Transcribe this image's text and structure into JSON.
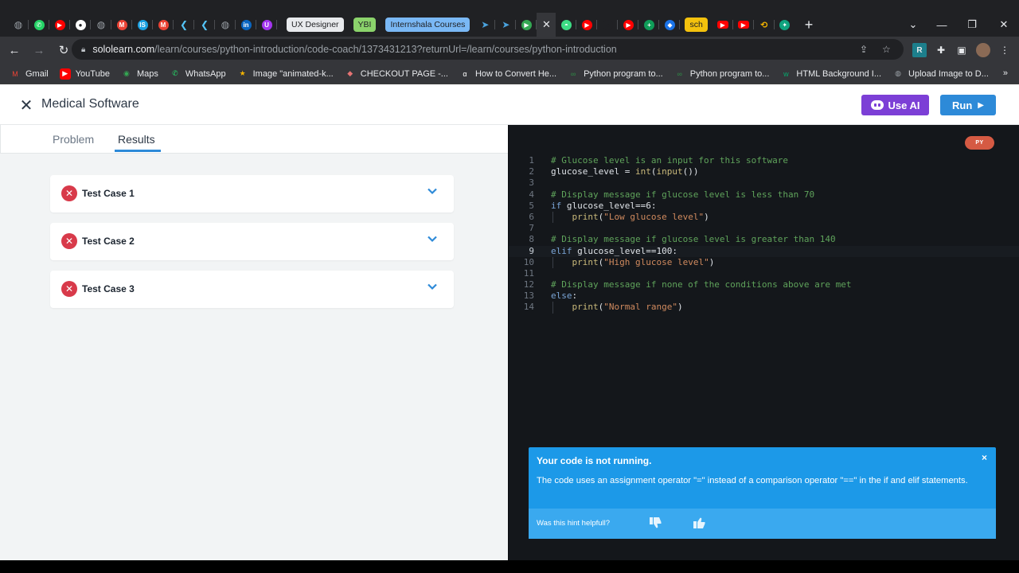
{
  "browser": {
    "tabs": [
      {
        "icon": "globe-icon",
        "color": "#9aa0a6"
      },
      {
        "icon": "whatsapp-icon",
        "color": "#25d366"
      },
      {
        "icon": "youtube-icon",
        "color": "#ff0000"
      },
      {
        "icon": "github-icon",
        "color": "#ffffff"
      },
      {
        "icon": "globe-icon",
        "color": "#9aa0a6"
      },
      {
        "icon": "gmail-icon",
        "color": "#ea4335"
      },
      {
        "icon": "internshala-icon",
        "color": "#1ba1e2"
      },
      {
        "icon": "gmail-icon",
        "color": "#ea4335"
      },
      {
        "icon": "flutter-icon",
        "color": "#54c5f8"
      },
      {
        "icon": "flutter-icon",
        "color": "#54c5f8"
      },
      {
        "icon": "globe-icon",
        "color": "#9aa0a6"
      },
      {
        "icon": "linkedin-icon",
        "color": "#0a66c2"
      },
      {
        "icon": "udemy-icon",
        "color": "#a435f0"
      }
    ],
    "tab_chips": [
      {
        "label": "UX Designer",
        "bg": "#e8eaed",
        "fg": "#202124"
      },
      {
        "label": "YBI",
        "bg": "#8bd36b",
        "fg": "#202124"
      },
      {
        "label": "Internshala Courses",
        "bg": "#7ab8f5",
        "fg": "#202124"
      }
    ],
    "right_tabs": [
      {
        "icon": "send-icon",
        "color": "#4aa3df"
      },
      {
        "icon": "send-icon",
        "color": "#4aa3df"
      },
      {
        "icon": "play-store-icon",
        "color": "#34a853"
      },
      {
        "icon": "close-icon",
        "color": "#e8eaed"
      },
      {
        "icon": "android-icon",
        "color": "#3ddc84"
      },
      {
        "icon": "youtube-icon",
        "color": "#ff0000"
      },
      {
        "icon": "github-icon",
        "color": "#202124"
      },
      {
        "icon": "youtube-icon",
        "color": "#ff0000"
      },
      {
        "icon": "plus-box-icon",
        "color": "#0f9d58"
      },
      {
        "icon": "shield-icon",
        "color": "#1a73e8"
      }
    ],
    "sch_chip": {
      "label": "sch",
      "bg": "#f4c20d",
      "fg": "#202124"
    },
    "url_host": "sololearn.com",
    "url_rest": "/learn/courses/python-introduction/code-coach/1373431213?returnUrl=/learn/courses/python-introduction",
    "bookmarks": [
      {
        "label": "Gmail",
        "icon": "gmail-icon",
        "color": "#ea4335"
      },
      {
        "label": "YouTube",
        "icon": "youtube-icon",
        "color": "#ff0000"
      },
      {
        "label": "Maps",
        "icon": "maps-icon",
        "color": "#34a853"
      },
      {
        "label": "WhatsApp",
        "icon": "whatsapp-icon",
        "color": "#25d366"
      },
      {
        "label": "Image \"animated-k...",
        "icon": "star-icon",
        "color": "#f4b400"
      },
      {
        "label": "CHECKOUT PAGE -...",
        "icon": "lips-icon",
        "color": "#e57373"
      },
      {
        "label": "How to Convert He...",
        "icon": "alpha-icon",
        "color": "#ffffff"
      },
      {
        "label": "Python program to...",
        "icon": "gfg-icon",
        "color": "#2f8d46"
      },
      {
        "label": "Python program to...",
        "icon": "gfg-icon",
        "color": "#2f8d46"
      },
      {
        "label": "HTML Background I...",
        "icon": "w3-icon",
        "color": "#04aa6d"
      },
      {
        "label": "Upload Image to D...",
        "icon": "globe-icon",
        "color": "#9aa0a6"
      }
    ],
    "bookmarks_more": "»"
  },
  "page": {
    "title": "Medical Software",
    "use_ai_label": "Use AI",
    "run_label": "Run",
    "tabs": {
      "problem": "Problem",
      "results": "Results"
    },
    "test_cases": [
      {
        "label": "Test Case 1",
        "status": "failed"
      },
      {
        "label": "Test Case 2",
        "status": "failed"
      },
      {
        "label": "Test Case 3",
        "status": "failed"
      }
    ],
    "language_badge": "PY",
    "colors": {
      "accent": "#2d8ad8",
      "ai": "#7c3fd6",
      "fail": "#d83a4a",
      "hint": "#1c99e8"
    }
  },
  "code": [
    {
      "n": "1",
      "tokens": [
        {
          "t": "# Glucose level is an input for this software",
          "c": "comment"
        }
      ]
    },
    {
      "n": "2",
      "tokens": [
        {
          "t": "glucose_level ",
          "c": "plain"
        },
        {
          "t": "=",
          "c": "op"
        },
        {
          "t": " ",
          "c": "plain"
        },
        {
          "t": "int",
          "c": "builtin"
        },
        {
          "t": "(",
          "c": "plain"
        },
        {
          "t": "input",
          "c": "builtin"
        },
        {
          "t": "())",
          "c": "plain"
        }
      ]
    },
    {
      "n": "3",
      "tokens": []
    },
    {
      "n": "4",
      "tokens": [
        {
          "t": "# Display message if glucose level is less than 70",
          "c": "comment"
        }
      ]
    },
    {
      "n": "5",
      "tokens": [
        {
          "t": "if",
          "c": "keyword"
        },
        {
          "t": " glucose_level",
          "c": "plain"
        },
        {
          "t": "==",
          "c": "op"
        },
        {
          "t": "6",
          "c": "plain"
        },
        {
          "t": ":",
          "c": "plain"
        }
      ]
    },
    {
      "n": "6",
      "indent": true,
      "tokens": [
        {
          "t": "    ",
          "c": "plain"
        },
        {
          "t": "print",
          "c": "builtin"
        },
        {
          "t": "(",
          "c": "plain"
        },
        {
          "t": "\"Low glucose level\"",
          "c": "string"
        },
        {
          "t": ")",
          "c": "plain"
        }
      ]
    },
    {
      "n": "7",
      "tokens": []
    },
    {
      "n": "8",
      "tokens": [
        {
          "t": "# Display message if glucose level is greater than 140",
          "c": "comment"
        }
      ]
    },
    {
      "n": "9",
      "current": true,
      "tokens": [
        {
          "t": "elif",
          "c": "keyword"
        },
        {
          "t": " glucose_level",
          "c": "plain"
        },
        {
          "t": "==",
          "c": "op"
        },
        {
          "t": "100",
          "c": "plain"
        },
        {
          "t": ":",
          "c": "plain"
        }
      ]
    },
    {
      "n": "10",
      "indent": true,
      "tokens": [
        {
          "t": "    ",
          "c": "plain"
        },
        {
          "t": "print",
          "c": "builtin"
        },
        {
          "t": "(",
          "c": "plain"
        },
        {
          "t": "\"High glucose level\"",
          "c": "string"
        },
        {
          "t": ")",
          "c": "plain"
        }
      ]
    },
    {
      "n": "11",
      "tokens": []
    },
    {
      "n": "12",
      "tokens": [
        {
          "t": "# Display message if none of the conditions above are met",
          "c": "comment"
        }
      ]
    },
    {
      "n": "13",
      "tokens": [
        {
          "t": "else",
          "c": "keyword"
        },
        {
          "t": ":",
          "c": "plain"
        }
      ]
    },
    {
      "n": "14",
      "indent": true,
      "tokens": [
        {
          "t": "    ",
          "c": "plain"
        },
        {
          "t": "print",
          "c": "builtin"
        },
        {
          "t": "(",
          "c": "plain"
        },
        {
          "t": "\"Normal range\"",
          "c": "string"
        },
        {
          "t": ")",
          "c": "plain"
        }
      ]
    }
  ],
  "syntax_colors": {
    "comment": "#5fa35b",
    "keyword": "#7aa5d6",
    "builtin": "#c9b97a",
    "string": "#d08a5e",
    "op": "#dfe3e8",
    "plain": "#dfe3e8"
  },
  "hint": {
    "title": "Your code is not running.",
    "body": "The code uses an assignment operator \"=\" instead of a comparison operator \"==\" in the if and elif statements.",
    "question": "Was this hint helpfull?",
    "close": "×"
  }
}
